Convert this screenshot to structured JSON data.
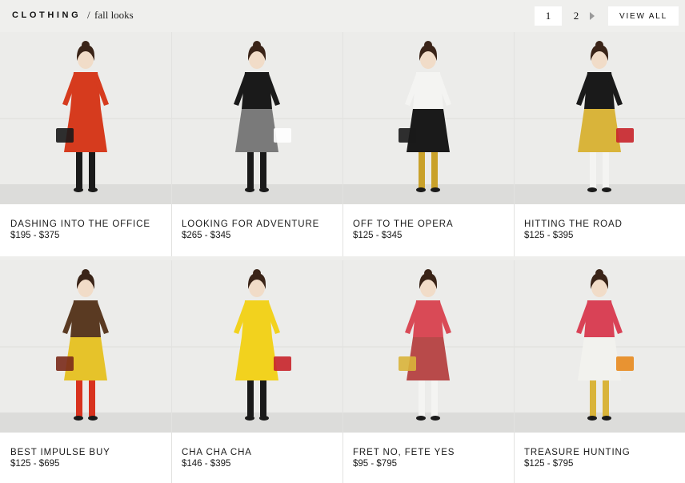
{
  "header": {
    "brand": "CLOTHING",
    "separator": "/",
    "breadcrumb": "fall looks"
  },
  "pagination": {
    "page1": "1",
    "page2": "2",
    "view_all": "VIEW ALL"
  },
  "looks": [
    {
      "title": "DASHING INTO THE OFFICE",
      "price": "$195 - $375",
      "dress": "#d63b1e",
      "top": "#d63b1e",
      "legs": "#1a1a1a",
      "accent": "#1a1a1a"
    },
    {
      "title": "LOOKING FOR ADVENTURE",
      "price": "$265 - $345",
      "dress": "#7a7a7a",
      "top": "#1a1a1a",
      "legs": "#1a1a1a",
      "accent": "#ffffff"
    },
    {
      "title": "OFF TO THE OPERA",
      "price": "$125 - $345",
      "dress": "#1a1a1a",
      "top": "#f4f4f2",
      "legs": "#c9a12a",
      "accent": "#1a1a1a"
    },
    {
      "title": "HITTING THE ROAD",
      "price": "$125 - $395",
      "dress": "#d9b43a",
      "top": "#1a1a1a",
      "legs": "#f4f4f2",
      "accent": "#c8242a"
    },
    {
      "title": "BEST IMPULSE BUY",
      "price": "$125 - $695",
      "dress": "#e6c32a",
      "top": "#5a3a22",
      "legs": "#d8321e",
      "accent": "#7a2a1a"
    },
    {
      "title": "CHA CHA CHA",
      "price": "$146 - $395",
      "dress": "#f2d21e",
      "top": "#f2d21e",
      "legs": "#1a1a1a",
      "accent": "#c8242a"
    },
    {
      "title": "FRET NO, FETE YES",
      "price": "$95 - $795",
      "dress": "#b84a4a",
      "top": "#d94a56",
      "legs": "#f4f4f2",
      "accent": "#d9b43a"
    },
    {
      "title": "TREASURE HUNTING",
      "price": "$125 - $795",
      "dress": "#f2f2ee",
      "top": "#d94256",
      "legs": "#d9b43a",
      "accent": "#e8891e"
    }
  ]
}
